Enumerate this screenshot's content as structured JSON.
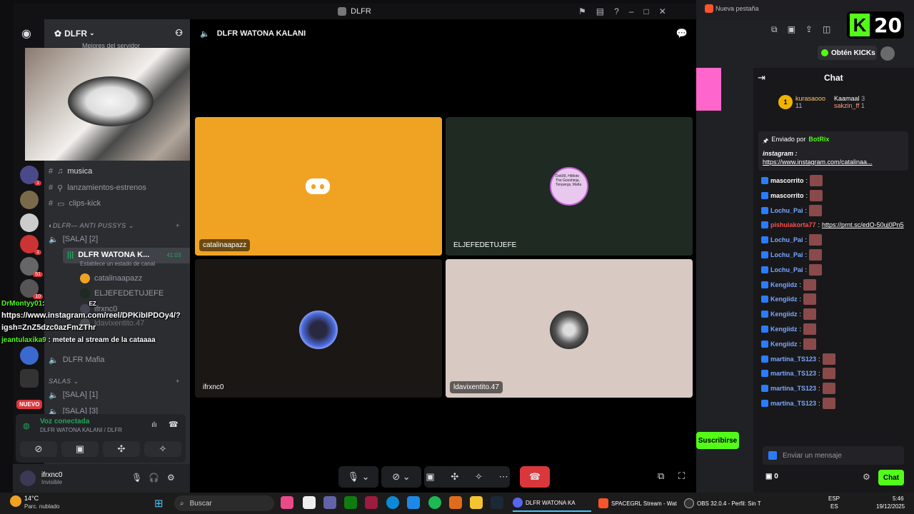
{
  "window": {
    "title": "DLFR"
  },
  "server": {
    "name": "DLFR"
  },
  "cat_video_caption": "Mejores del servidor",
  "channels": {
    "musica": "musica",
    "lanzamientos": "lanzamientos-estrenos",
    "clips": "clips-kick",
    "category_anti": "DLFR— ANTI PUSSYS",
    "sala2": "[SALA] [2]",
    "watona": "DLFR WATONA K...",
    "watona_time": "41:03",
    "watona_status": "Establece un estado de canal",
    "members": [
      "catalinaapazz",
      "ELJEFEDETUJEFE",
      "ifrxnc0",
      "ldavixentito.47"
    ],
    "mafia": "DLFR Mafia",
    "category_salas": "SALAS",
    "sala1": "[SALA] [1]",
    "sala3": "[SALA] [3]"
  },
  "guild_badges": [
    "1",
    "1",
    "51",
    "10"
  ],
  "nuevo_badge": "NUEVO",
  "voice": {
    "status": "Voz conectada",
    "location": "DLFR WATONA KALANI / DLFR"
  },
  "user": {
    "name": "ifrxnc0",
    "status": "Invisible"
  },
  "call": {
    "title": "DLFR WATONA KALANI",
    "participants": [
      "catalinaapazz",
      "ELJEFEDETUJEFE",
      "ifrxnc0",
      "ldavixentito.47"
    ],
    "avatar_text": "Dok99, HiMoto The Gooshinja, Tonywrgs, Mafia"
  },
  "overlay_chat": {
    "line1_name": "DrMontyy01",
    "line1_text": "https://www.instagram.com/reel/DPKibIPDOy4/?",
    "line2_text": "igsh=ZnZ5dzc0azFmZThr",
    "line3_name": "jeantulaxika9",
    "line3_text": "metete al stream de la cataaaa",
    "ez": "EZ"
  },
  "browser": {
    "tab_title": "Nueva pestaña",
    "obtain_kicks": "Obtén KICKs",
    "kick_counter": "20"
  },
  "kick_chat": {
    "header": "Chat",
    "top_gifter": "kurasaooo",
    "top_gifter_count": "11",
    "gifter2": "Kaamaal",
    "gifter2_count": "3",
    "gifter3": "sakzin_ff",
    "gifter3_count": "1",
    "pinned_by": "Enviado por",
    "pinned_bot": "BotRix",
    "pinned_title": "instagram :",
    "pinned_link": "https://www.instagram.com/catalinaa...",
    "messages": [
      {
        "name": "mascorrito",
        "text": ""
      },
      {
        "name": "mascorrito",
        "text": ""
      },
      {
        "name": "Lochu_Pai",
        "text": ""
      },
      {
        "name": "pishuiakorta77",
        "text": "https://prnt.sc/edO-50uj0Pn5"
      },
      {
        "name": "Lochu_Pai",
        "text": ""
      },
      {
        "name": "Lochu_Pai",
        "text": ""
      },
      {
        "name": "Lochu_Pai",
        "text": ""
      },
      {
        "name": "Kengiidz",
        "text": ""
      },
      {
        "name": "Kengiidz",
        "text": ""
      },
      {
        "name": "Kengiidz",
        "text": ""
      },
      {
        "name": "Kengiidz",
        "text": ""
      },
      {
        "name": "Kengiidz",
        "text": ""
      },
      {
        "name": "martina_TS123",
        "text": ""
      },
      {
        "name": "martina_TS123",
        "text": ""
      },
      {
        "name": "martina_TS123",
        "text": ""
      },
      {
        "name": "martina_TS123",
        "text": ""
      }
    ],
    "input_placeholder": "Enviar un mensaje",
    "points": "0",
    "chat_button": "Chat",
    "subscribe": "Suscribirse"
  },
  "taskbar": {
    "weather_temp": "14°C",
    "weather_desc": "Parc. nublado",
    "search": "Buscar",
    "discord_app": "DLFR WATONA KA",
    "brave_app": "SPACEGRL Stream - Wat",
    "obs_app": "OBS 32.0.4 - Perfil: Sin T",
    "lang": "ESP",
    "lang2": "ES",
    "time": "5:46",
    "date": "19/12/2025"
  },
  "colors": {
    "discord_orange": "#f0a323",
    "discord_green_tile": "#1e2a22",
    "kick_green": "#53fc18",
    "hangup": "#da373c"
  }
}
